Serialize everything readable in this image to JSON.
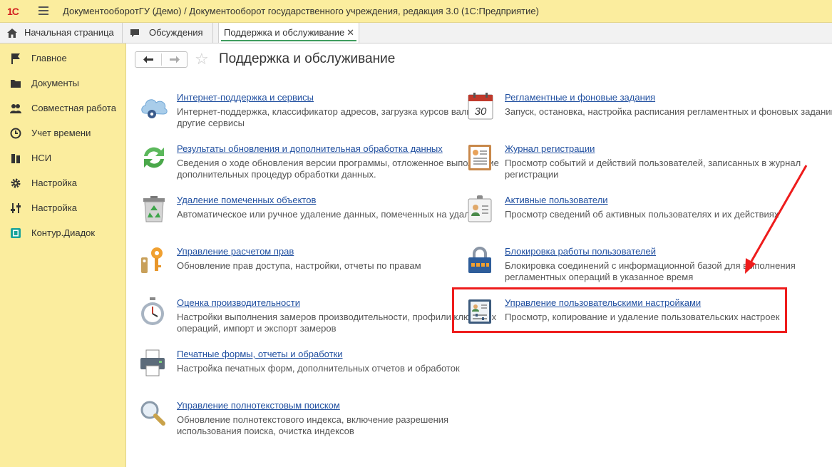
{
  "window": {
    "logo": "1С",
    "title": "ДокументооборотГУ (Демо) / Документооборот государственного учреждения, редакция 3.0  (1С:Предприятие)"
  },
  "tabs": [
    {
      "label": "Начальная страница",
      "icon": "home-icon"
    },
    {
      "label": "Обсуждения",
      "icon": "chat-icon"
    },
    {
      "label": "Поддержка и обслуживание",
      "active": true,
      "close": "✕"
    }
  ],
  "sidebar": {
    "items": [
      {
        "label": "Главное",
        "icon": "flag-icon"
      },
      {
        "label": "Документы",
        "icon": "folder-icon"
      },
      {
        "label": "Совместная работа",
        "icon": "people-icon"
      },
      {
        "label": "Учет времени",
        "icon": "clock-icon"
      },
      {
        "label": "НСИ",
        "icon": "books-icon"
      },
      {
        "label": "Настройка",
        "icon": "gear-icon"
      },
      {
        "label": "Настройка",
        "icon": "sliders-icon"
      },
      {
        "label": "Контур.Диадок",
        "icon": "diadoc-icon"
      }
    ]
  },
  "page": {
    "title": "Поддержка и обслуживание",
    "back_label": "←",
    "forward_label": "→",
    "star": "☆"
  },
  "left_items": [
    {
      "title": "Интернет-поддержка и сервисы",
      "desc": "Интернет-поддержка, классификатор адресов, загрузка курсов валют и другие сервисы",
      "icon": "cloud-gear-icon"
    },
    {
      "title": "Результаты обновления и дополнительная обработка данных",
      "desc": "Сведения о ходе обновления версии программы, отложенное выполнение дополнительных процедур обработки данных.",
      "icon": "refresh-icon"
    },
    {
      "title": "Удаление помеченных объектов",
      "desc": "Автоматическое или ручное удаление данных, помеченных на удаление",
      "icon": "recycle-bin-icon"
    },
    {
      "title": "Управление расчетом прав",
      "desc": "Обновление прав доступа, настройки, отчеты по правам",
      "icon": "keys-icon"
    },
    {
      "title": "Оценка производительности",
      "desc": "Настройки выполнения замеров производительности, профили ключевых операций, импорт и экспорт замеров",
      "icon": "stopwatch-icon"
    },
    {
      "title": "Печатные формы, отчеты и обработки",
      "desc": "Настройка печатных форм, дополнительных отчетов и обработок",
      "icon": "printer-icon"
    },
    {
      "title": "Управление полнотекстовым поиском",
      "desc": "Обновление полнотекстового индекса, включение разрешения использования поиска, очистка индексов",
      "icon": "magnifier-icon"
    }
  ],
  "right_items": [
    {
      "title": "Регламентные и фоновые задания",
      "desc": "Запуск, остановка, настройка расписания регламентных и фоновых заданий",
      "icon": "calendar-icon",
      "calendar_day": "30"
    },
    {
      "title": "Журнал регистрации",
      "desc": "Просмотр событий и действий пользователей, записанных в журнал регистрации",
      "icon": "journal-icon"
    },
    {
      "title": "Активные пользователи",
      "desc": "Просмотр сведений об активных пользователях и их действиях",
      "icon": "id-card-icon"
    },
    {
      "title": "Блокировка работы пользователей",
      "desc": "Блокировка соединений с информационной базой для выполнения регламентных операций в указанное время",
      "icon": "padlock-icon"
    },
    {
      "title": "Управление пользовательскими настройками",
      "desc": "Просмотр, копирование и удаление пользовательских настроек",
      "icon": "user-settings-icon"
    }
  ],
  "colors": {
    "panel_yellow": "#fbed9e",
    "link_blue": "#204fa0",
    "annotation_red": "#ee1c1c",
    "active_tab_underline": "#3f9c5e"
  }
}
